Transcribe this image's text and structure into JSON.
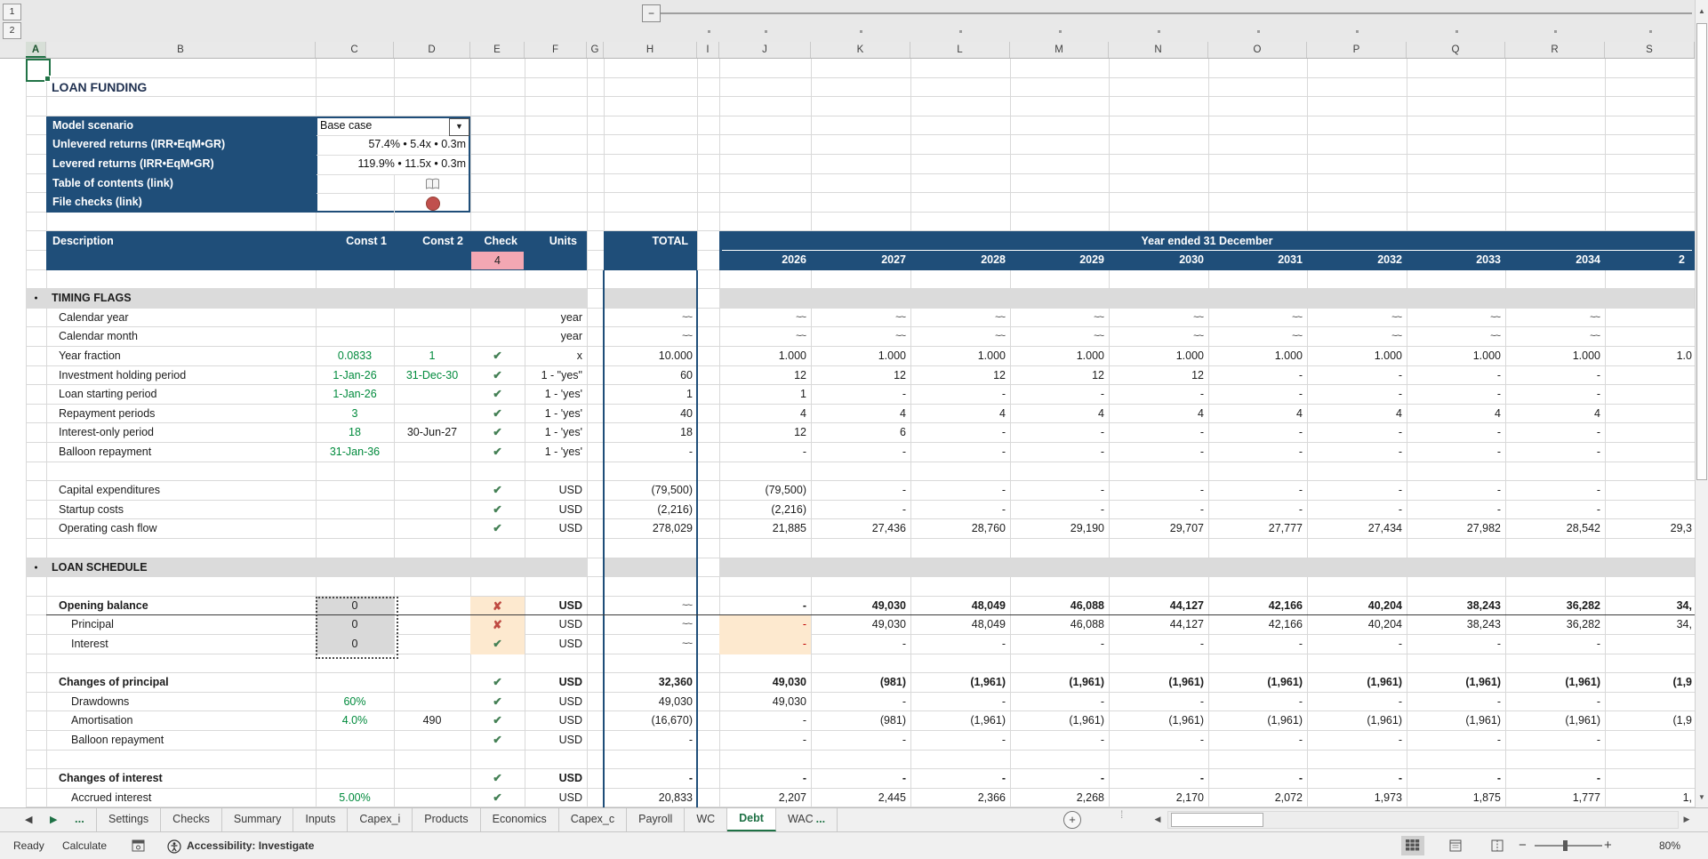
{
  "outline": {
    "levels": [
      "1",
      "2"
    ],
    "collapse": "−"
  },
  "grid": {
    "columns": [
      "A",
      "B",
      "C",
      "D",
      "E",
      "F",
      "G",
      "H",
      "I",
      "J",
      "K",
      "L",
      "M",
      "N",
      "O",
      "P",
      "Q",
      "R",
      "S"
    ],
    "row_count": 39,
    "selected_cell": "A1"
  },
  "title": "LOAN FUNDING",
  "scenario": {
    "rows": [
      {
        "label": "Model scenario",
        "value": "Base case",
        "type": "dropdown"
      },
      {
        "label": "Unlevered returns (IRR•EqM•GR)",
        "value": "57.4% • 5.4x • 0.3m",
        "type": "text"
      },
      {
        "label": "Levered returns (IRR•EqM•GR)",
        "value": "119.9% • 11.5x • 0.3m",
        "type": "text"
      },
      {
        "label": "Table of contents (link)",
        "value": "",
        "type": "book-icon"
      },
      {
        "label": "File checks (link)",
        "value": "",
        "type": "red-circle-icon"
      }
    ]
  },
  "header": {
    "description": "Description",
    "const1": "Const 1",
    "const2": "Const 2",
    "check": "Check",
    "units": "Units",
    "check_count": "4",
    "total": "TOTAL",
    "banner": "Year ended 31 December",
    "years": [
      "2026",
      "2027",
      "2028",
      "2029",
      "2030",
      "2031",
      "2032",
      "2033",
      "2034"
    ],
    "year_clipped": "2"
  },
  "rows": {
    "2": [
      [
        "B",
        "title",
        "LOAN FUNDING"
      ]
    ],
    "13": [
      [
        "AF",
        "band",
        ""
      ],
      [
        "H",
        "band",
        ""
      ],
      [
        "JS",
        "band",
        ""
      ],
      [
        "A",
        "bdot",
        "●"
      ],
      [
        "B",
        "blbl",
        "TIMING FLAGS"
      ]
    ],
    "14": [
      [
        "B",
        "l1",
        "Calendar year"
      ],
      [
        "F",
        "u",
        "year"
      ],
      [
        "H",
        "w",
        "~~"
      ],
      [
        "J",
        "w",
        "~~"
      ],
      [
        "K",
        "w",
        "~~"
      ],
      [
        "L",
        "w",
        "~~"
      ],
      [
        "M",
        "w",
        "~~"
      ],
      [
        "N",
        "w",
        "~~"
      ],
      [
        "O",
        "w",
        "~~"
      ],
      [
        "P",
        "w",
        "~~"
      ],
      [
        "Q",
        "w",
        "~~"
      ],
      [
        "R",
        "w",
        "~~"
      ]
    ],
    "15": [
      [
        "B",
        "l1",
        "Calendar month"
      ],
      [
        "F",
        "u",
        "year"
      ],
      [
        "H",
        "w",
        "~~"
      ],
      [
        "J",
        "w",
        "~~"
      ],
      [
        "K",
        "w",
        "~~"
      ],
      [
        "L",
        "w",
        "~~"
      ],
      [
        "M",
        "w",
        "~~"
      ],
      [
        "N",
        "w",
        "~~"
      ],
      [
        "O",
        "w",
        "~~"
      ],
      [
        "P",
        "w",
        "~~"
      ],
      [
        "Q",
        "w",
        "~~"
      ],
      [
        "R",
        "w",
        "~~"
      ]
    ],
    "16": [
      [
        "B",
        "l1",
        "Year fraction"
      ],
      [
        "C",
        "g",
        "0.0833"
      ],
      [
        "D",
        "g",
        "1"
      ],
      [
        "E",
        "ck",
        "✔"
      ],
      [
        "F",
        "u",
        "x"
      ],
      [
        "H",
        "n",
        "10.000"
      ],
      [
        "J",
        "n",
        "1.000"
      ],
      [
        "K",
        "n",
        "1.000"
      ],
      [
        "L",
        "n",
        "1.000"
      ],
      [
        "M",
        "n",
        "1.000"
      ],
      [
        "N",
        "n",
        "1.000"
      ],
      [
        "O",
        "n",
        "1.000"
      ],
      [
        "P",
        "n",
        "1.000"
      ],
      [
        "Q",
        "n",
        "1.000"
      ],
      [
        "R",
        "n",
        "1.000"
      ],
      [
        "S",
        "cl",
        "1.0"
      ]
    ],
    "17": [
      [
        "B",
        "l1",
        "Investment holding period"
      ],
      [
        "C",
        "g",
        "1-Jan-26"
      ],
      [
        "D",
        "g",
        "31-Dec-30"
      ],
      [
        "E",
        "ck",
        "✔"
      ],
      [
        "F",
        "u",
        "1 - \"yes\""
      ],
      [
        "H",
        "n",
        "60"
      ],
      [
        "J",
        "n",
        "12"
      ],
      [
        "K",
        "n",
        "12"
      ],
      [
        "L",
        "n",
        "12"
      ],
      [
        "M",
        "n",
        "12"
      ],
      [
        "N",
        "n",
        "12"
      ],
      [
        "O",
        "n",
        "-"
      ],
      [
        "P",
        "n",
        "-"
      ],
      [
        "Q",
        "n",
        "-"
      ],
      [
        "R",
        "n",
        "-"
      ]
    ],
    "18": [
      [
        "B",
        "l1",
        "Loan starting period"
      ],
      [
        "C",
        "g",
        "1-Jan-26"
      ],
      [
        "E",
        "ck",
        "✔"
      ],
      [
        "F",
        "u",
        "1 - 'yes'"
      ],
      [
        "H",
        "n",
        "1"
      ],
      [
        "J",
        "n",
        "1"
      ],
      [
        "K",
        "n",
        "-"
      ],
      [
        "L",
        "n",
        "-"
      ],
      [
        "M",
        "n",
        "-"
      ],
      [
        "N",
        "n",
        "-"
      ],
      [
        "O",
        "n",
        "-"
      ],
      [
        "P",
        "n",
        "-"
      ],
      [
        "Q",
        "n",
        "-"
      ],
      [
        "R",
        "n",
        "-"
      ]
    ],
    "19": [
      [
        "B",
        "l1",
        "Repayment periods"
      ],
      [
        "C",
        "g",
        "3"
      ],
      [
        "E",
        "ck",
        "✔"
      ],
      [
        "F",
        "u",
        "1 - 'yes'"
      ],
      [
        "H",
        "n",
        "40"
      ],
      [
        "J",
        "n",
        "4"
      ],
      [
        "K",
        "n",
        "4"
      ],
      [
        "L",
        "n",
        "4"
      ],
      [
        "M",
        "n",
        "4"
      ],
      [
        "N",
        "n",
        "4"
      ],
      [
        "O",
        "n",
        "4"
      ],
      [
        "P",
        "n",
        "4"
      ],
      [
        "Q",
        "n",
        "4"
      ],
      [
        "R",
        "n",
        "4"
      ]
    ],
    "20": [
      [
        "B",
        "l1",
        "Interest-only period"
      ],
      [
        "C",
        "g",
        "18"
      ],
      [
        "D",
        "c",
        "30-Jun-27"
      ],
      [
        "E",
        "ck",
        "✔"
      ],
      [
        "F",
        "u",
        "1 - 'yes'"
      ],
      [
        "H",
        "n",
        "18"
      ],
      [
        "J",
        "n",
        "12"
      ],
      [
        "K",
        "n",
        "6"
      ],
      [
        "L",
        "n",
        "-"
      ],
      [
        "M",
        "n",
        "-"
      ],
      [
        "N",
        "n",
        "-"
      ],
      [
        "O",
        "n",
        "-"
      ],
      [
        "P",
        "n",
        "-"
      ],
      [
        "Q",
        "n",
        "-"
      ],
      [
        "R",
        "n",
        "-"
      ]
    ],
    "21": [
      [
        "B",
        "l1",
        "Balloon repayment"
      ],
      [
        "C",
        "g",
        "31-Jan-36"
      ],
      [
        "E",
        "ck",
        "✔"
      ],
      [
        "F",
        "u",
        "1 - 'yes'"
      ],
      [
        "H",
        "n",
        "-"
      ],
      [
        "J",
        "n",
        "-"
      ],
      [
        "K",
        "n",
        "-"
      ],
      [
        "L",
        "n",
        "-"
      ],
      [
        "M",
        "n",
        "-"
      ],
      [
        "N",
        "n",
        "-"
      ],
      [
        "O",
        "n",
        "-"
      ],
      [
        "P",
        "n",
        "-"
      ],
      [
        "Q",
        "n",
        "-"
      ],
      [
        "R",
        "n",
        "-"
      ]
    ],
    "23": [
      [
        "B",
        "l1",
        "Capital expenditures"
      ],
      [
        "E",
        "ck",
        "✔"
      ],
      [
        "F",
        "u",
        "USD"
      ],
      [
        "H",
        "n",
        "(79,500)"
      ],
      [
        "J",
        "n",
        "(79,500)"
      ],
      [
        "K",
        "n",
        "-"
      ],
      [
        "L",
        "n",
        "-"
      ],
      [
        "M",
        "n",
        "-"
      ],
      [
        "N",
        "n",
        "-"
      ],
      [
        "O",
        "n",
        "-"
      ],
      [
        "P",
        "n",
        "-"
      ],
      [
        "Q",
        "n",
        "-"
      ],
      [
        "R",
        "n",
        "-"
      ]
    ],
    "24": [
      [
        "B",
        "l1",
        "Startup costs"
      ],
      [
        "E",
        "ck",
        "✔"
      ],
      [
        "F",
        "u",
        "USD"
      ],
      [
        "H",
        "n",
        "(2,216)"
      ],
      [
        "J",
        "n",
        "(2,216)"
      ],
      [
        "K",
        "n",
        "-"
      ],
      [
        "L",
        "n",
        "-"
      ],
      [
        "M",
        "n",
        "-"
      ],
      [
        "N",
        "n",
        "-"
      ],
      [
        "O",
        "n",
        "-"
      ],
      [
        "P",
        "n",
        "-"
      ],
      [
        "Q",
        "n",
        "-"
      ],
      [
        "R",
        "n",
        "-"
      ]
    ],
    "25": [
      [
        "B",
        "l1",
        "Operating cash flow"
      ],
      [
        "E",
        "ck",
        "✔"
      ],
      [
        "F",
        "u",
        "USD"
      ],
      [
        "H",
        "n",
        "278,029"
      ],
      [
        "J",
        "n",
        "21,885"
      ],
      [
        "K",
        "n",
        "27,436"
      ],
      [
        "L",
        "n",
        "28,760"
      ],
      [
        "M",
        "n",
        "29,190"
      ],
      [
        "N",
        "n",
        "29,707"
      ],
      [
        "O",
        "n",
        "27,777"
      ],
      [
        "P",
        "n",
        "27,434"
      ],
      [
        "Q",
        "n",
        "27,982"
      ],
      [
        "R",
        "n",
        "28,542"
      ],
      [
        "S",
        "cl",
        "29,3"
      ]
    ],
    "27": [
      [
        "AF",
        "band",
        ""
      ],
      [
        "H",
        "band",
        ""
      ],
      [
        "JS",
        "band",
        ""
      ],
      [
        "A",
        "bdot",
        "●"
      ],
      [
        "B",
        "blbl",
        "LOAN SCHEDULE"
      ]
    ],
    "29": [
      [
        "B",
        "l1 b",
        "Opening balance"
      ],
      [
        "C",
        "g0",
        "0"
      ],
      [
        "E",
        "cxo",
        "✘"
      ],
      [
        "F",
        "ub",
        "USD"
      ],
      [
        "H",
        "w",
        "~~"
      ],
      [
        "J",
        "nb",
        "-"
      ],
      [
        "K",
        "nb",
        "49,030"
      ],
      [
        "L",
        "nb",
        "48,049"
      ],
      [
        "M",
        "nb",
        "46,088"
      ],
      [
        "N",
        "nb",
        "44,127"
      ],
      [
        "O",
        "nb",
        "42,166"
      ],
      [
        "P",
        "nb",
        "40,204"
      ],
      [
        "Q",
        "nb",
        "38,243"
      ],
      [
        "R",
        "nb",
        "36,282"
      ],
      [
        "S",
        "clb",
        "34,"
      ]
    ],
    "30": [
      [
        "B",
        "l2",
        "Principal"
      ],
      [
        "C",
        "g0",
        "0"
      ],
      [
        "E",
        "cxo",
        "✘"
      ],
      [
        "F",
        "u",
        "USD"
      ],
      [
        "H",
        "w",
        "~~"
      ],
      [
        "J",
        "jo",
        "-"
      ],
      [
        "K",
        "n",
        "49,030"
      ],
      [
        "L",
        "n",
        "48,049"
      ],
      [
        "M",
        "n",
        "46,088"
      ],
      [
        "N",
        "n",
        "44,127"
      ],
      [
        "O",
        "n",
        "42,166"
      ],
      [
        "P",
        "n",
        "40,204"
      ],
      [
        "Q",
        "n",
        "38,243"
      ],
      [
        "R",
        "n",
        "36,282"
      ],
      [
        "S",
        "cl",
        "34,"
      ]
    ],
    "31": [
      [
        "B",
        "l2",
        "Interest"
      ],
      [
        "C",
        "g0",
        "0"
      ],
      [
        "E",
        "cko",
        "✔"
      ],
      [
        "F",
        "u",
        "USD"
      ],
      [
        "H",
        "w",
        "~~"
      ],
      [
        "J",
        "jo",
        "-"
      ],
      [
        "K",
        "n",
        "-"
      ],
      [
        "L",
        "n",
        "-"
      ],
      [
        "M",
        "n",
        "-"
      ],
      [
        "N",
        "n",
        "-"
      ],
      [
        "O",
        "n",
        "-"
      ],
      [
        "P",
        "n",
        "-"
      ],
      [
        "Q",
        "n",
        "-"
      ],
      [
        "R",
        "n",
        "-"
      ]
    ],
    "33": [
      [
        "B",
        "l1 b",
        "Changes of principal"
      ],
      [
        "E",
        "ck",
        "✔"
      ],
      [
        "F",
        "ub",
        "USD"
      ],
      [
        "H",
        "nb",
        "32,360"
      ],
      [
        "J",
        "nb",
        "49,030"
      ],
      [
        "K",
        "nb",
        "(981)"
      ],
      [
        "L",
        "nb",
        "(1,961)"
      ],
      [
        "M",
        "nb",
        "(1,961)"
      ],
      [
        "N",
        "nb",
        "(1,961)"
      ],
      [
        "O",
        "nb",
        "(1,961)"
      ],
      [
        "P",
        "nb",
        "(1,961)"
      ],
      [
        "Q",
        "nb",
        "(1,961)"
      ],
      [
        "R",
        "nb",
        "(1,961)"
      ],
      [
        "S",
        "clb",
        "(1,9"
      ]
    ],
    "34": [
      [
        "B",
        "l2",
        "Drawdowns"
      ],
      [
        "C",
        "g",
        "60%"
      ],
      [
        "E",
        "ck",
        "✔"
      ],
      [
        "F",
        "u",
        "USD"
      ],
      [
        "H",
        "n",
        "49,030"
      ],
      [
        "J",
        "n",
        "49,030"
      ],
      [
        "K",
        "n",
        "-"
      ],
      [
        "L",
        "n",
        "-"
      ],
      [
        "M",
        "n",
        "-"
      ],
      [
        "N",
        "n",
        "-"
      ],
      [
        "O",
        "n",
        "-"
      ],
      [
        "P",
        "n",
        "-"
      ],
      [
        "Q",
        "n",
        "-"
      ],
      [
        "R",
        "n",
        "-"
      ]
    ],
    "35": [
      [
        "B",
        "l2",
        "Amortisation"
      ],
      [
        "C",
        "g",
        "4.0%"
      ],
      [
        "D",
        "c",
        "490"
      ],
      [
        "E",
        "ck",
        "✔"
      ],
      [
        "F",
        "u",
        "USD"
      ],
      [
        "H",
        "n",
        "(16,670)"
      ],
      [
        "J",
        "n",
        "-"
      ],
      [
        "K",
        "n",
        "(981)"
      ],
      [
        "L",
        "n",
        "(1,961)"
      ],
      [
        "M",
        "n",
        "(1,961)"
      ],
      [
        "N",
        "n",
        "(1,961)"
      ],
      [
        "O",
        "n",
        "(1,961)"
      ],
      [
        "P",
        "n",
        "(1,961)"
      ],
      [
        "Q",
        "n",
        "(1,961)"
      ],
      [
        "R",
        "n",
        "(1,961)"
      ],
      [
        "S",
        "cl",
        "(1,9"
      ]
    ],
    "36": [
      [
        "B",
        "l2",
        "Balloon repayment"
      ],
      [
        "E",
        "ck",
        "✔"
      ],
      [
        "F",
        "u",
        "USD"
      ],
      [
        "H",
        "n",
        "-"
      ],
      [
        "J",
        "n",
        "-"
      ],
      [
        "K",
        "n",
        "-"
      ],
      [
        "L",
        "n",
        "-"
      ],
      [
        "M",
        "n",
        "-"
      ],
      [
        "N",
        "n",
        "-"
      ],
      [
        "O",
        "n",
        "-"
      ],
      [
        "P",
        "n",
        "-"
      ],
      [
        "Q",
        "n",
        "-"
      ],
      [
        "R",
        "n",
        "-"
      ]
    ],
    "38": [
      [
        "B",
        "l1 b",
        "Changes of interest"
      ],
      [
        "E",
        "ck",
        "✔"
      ],
      [
        "F",
        "ub",
        "USD"
      ],
      [
        "H",
        "nb",
        "-"
      ],
      [
        "J",
        "nb",
        "-"
      ],
      [
        "K",
        "nb",
        "-"
      ],
      [
        "L",
        "nb",
        "-"
      ],
      [
        "M",
        "nb",
        "-"
      ],
      [
        "N",
        "nb",
        "-"
      ],
      [
        "O",
        "nb",
        "-"
      ],
      [
        "P",
        "nb",
        "-"
      ],
      [
        "Q",
        "nb",
        "-"
      ],
      [
        "R",
        "nb",
        "-"
      ]
    ],
    "39": [
      [
        "B",
        "l2",
        "Accrued interest"
      ],
      [
        "C",
        "g",
        "5.00%"
      ],
      [
        "E",
        "ck",
        "✔"
      ],
      [
        "F",
        "u",
        "USD"
      ],
      [
        "H",
        "n",
        "20,833"
      ],
      [
        "J",
        "n",
        "2,207"
      ],
      [
        "K",
        "n",
        "2,445"
      ],
      [
        "L",
        "n",
        "2,366"
      ],
      [
        "M",
        "n",
        "2,268"
      ],
      [
        "N",
        "n",
        "2,170"
      ],
      [
        "O",
        "n",
        "2,072"
      ],
      [
        "P",
        "n",
        "1,973"
      ],
      [
        "Q",
        "n",
        "1,875"
      ],
      [
        "R",
        "n",
        "1,777"
      ],
      [
        "S",
        "cl",
        "1,"
      ]
    ]
  },
  "tabs": {
    "nav_left": "◀",
    "nav_right": "▶",
    "overflow": "...",
    "sheets": [
      {
        "label": "Settings"
      },
      {
        "label": "Checks"
      },
      {
        "label": "Summary"
      },
      {
        "label": "Inputs"
      },
      {
        "label": "Capex_i"
      },
      {
        "label": "Products"
      },
      {
        "label": "Economics"
      },
      {
        "label": "Capex_c"
      },
      {
        "label": "Payroll"
      },
      {
        "label": "WC"
      },
      {
        "label": "Debt",
        "active": true
      },
      {
        "label": "WAC",
        "clipped": true
      }
    ],
    "add": "+"
  },
  "status": {
    "ready": "Ready",
    "calculate": "Calculate",
    "accessibility": "Accessibility: Investigate",
    "zoom": "80%"
  }
}
